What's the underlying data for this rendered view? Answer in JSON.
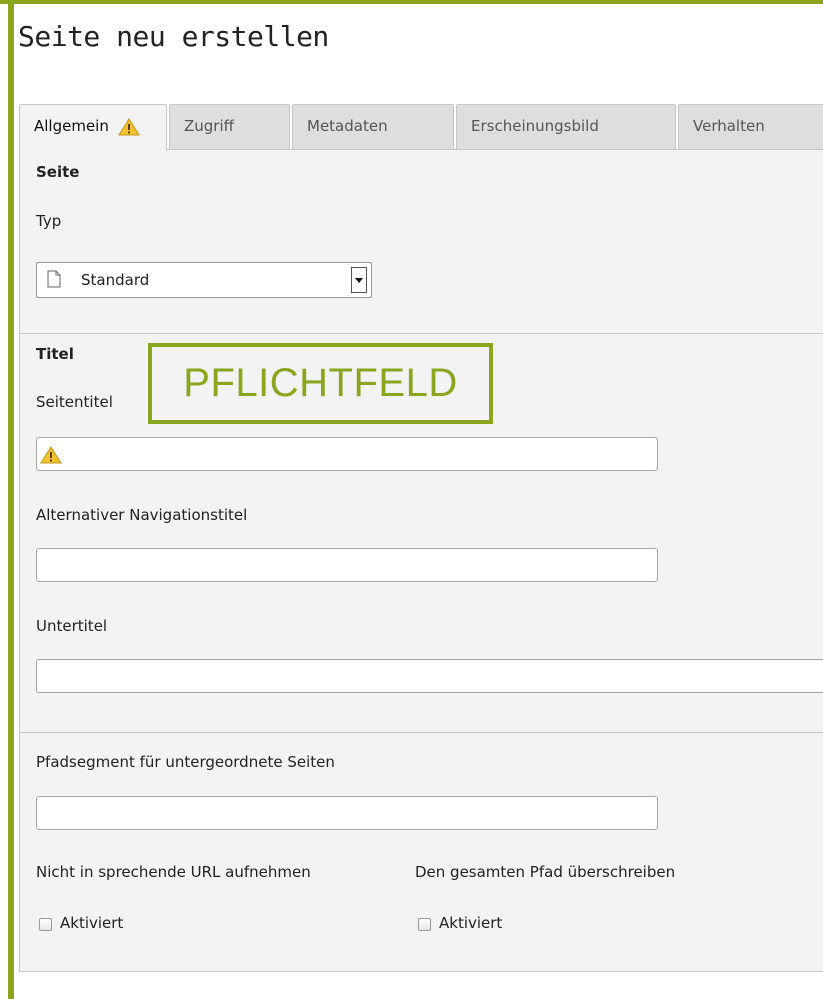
{
  "page_title": "Seite neu erstellen",
  "tabs": [
    {
      "label": "Allgemein",
      "icon": "warning-icon",
      "active": true
    },
    {
      "label": "Zugriff"
    },
    {
      "label": "Metadaten"
    },
    {
      "label": "Erscheinungsbild"
    },
    {
      "label": "Verhalten"
    }
  ],
  "colors": {
    "accent": "#8aa61f",
    "panel": "#f3f3f3",
    "warning": "#f2c230"
  },
  "section_page": {
    "heading": "Seite",
    "type_label": "Typ",
    "type_select": {
      "value": "Standard",
      "icon": "document-icon"
    }
  },
  "section_title": {
    "heading": "Titel",
    "callout": "PFLICHTFELD",
    "page_title_label": "Seitentitel",
    "page_title_value": "",
    "nav_title_label": "Alternativer Navigationstitel",
    "nav_title_value": "",
    "subtitle_label": "Untertitel",
    "subtitle_value": ""
  },
  "section_path": {
    "path_label": "Pfadsegment für untergeordnete Seiten",
    "path_value": "",
    "exclude_url_label": "Nicht in sprechende URL aufnehmen",
    "exclude_url_checkbox": "Aktiviert",
    "override_path_label": "Den gesamten Pfad überschreiben",
    "override_path_checkbox": "Aktiviert"
  }
}
